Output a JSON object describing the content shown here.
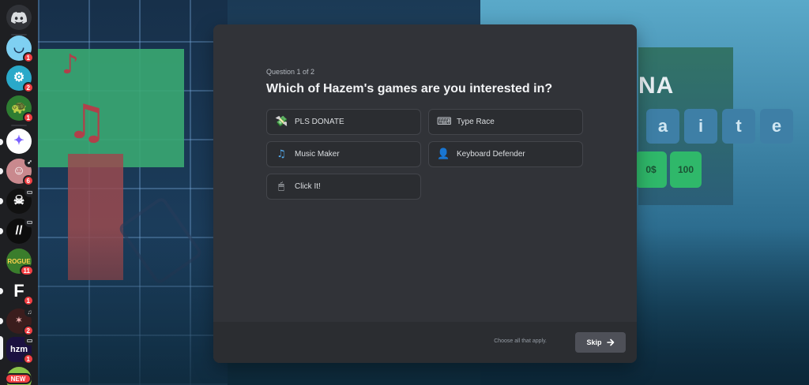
{
  "rail": {
    "servers": [
      {
        "id": "discord-home",
        "badge": ""
      },
      {
        "id": "server-1",
        "badge": "1"
      },
      {
        "id": "server-2",
        "badge": "2"
      },
      {
        "id": "server-3",
        "badge": "1"
      },
      {
        "id": "server-4",
        "badge": ""
      },
      {
        "id": "server-5",
        "badge": "6"
      },
      {
        "id": "server-6",
        "badge": ""
      },
      {
        "id": "server-7",
        "badge": ""
      },
      {
        "id": "server-8",
        "badge": "11",
        "label": "ROGUE"
      },
      {
        "id": "server-9",
        "badge": "1"
      },
      {
        "id": "server-10",
        "badge": "2"
      },
      {
        "id": "server-11",
        "badge": "1",
        "label": "hzm"
      },
      {
        "id": "server-12",
        "badge": "",
        "label": "NEW"
      }
    ]
  },
  "background": {
    "banner_text": "NA",
    "keycaps": [
      "a",
      "i",
      "t",
      "e"
    ],
    "coins": [
      "0$",
      "100"
    ]
  },
  "modal": {
    "question_count": "Question 1 of 2",
    "title": "Which of Hazem's games are you interested in?",
    "options": [
      {
        "label": "PLS DONATE",
        "icon": "money-icon"
      },
      {
        "label": "Type Race",
        "icon": "keyboard-icon"
      },
      {
        "label": "Music Maker",
        "icon": "music-note-icon"
      },
      {
        "label": "Keyboard Defender",
        "icon": "defender-icon"
      },
      {
        "label": "Click It!",
        "icon": "mouse-icon"
      }
    ],
    "footer": {
      "hint": "Choose all that apply.",
      "skip_label": "Skip"
    }
  },
  "colors": {
    "modal_bg": "#313338",
    "footer_bg": "#2b2d31",
    "badge_red": "#f23f43",
    "discord_blurple": "#5865f2"
  }
}
